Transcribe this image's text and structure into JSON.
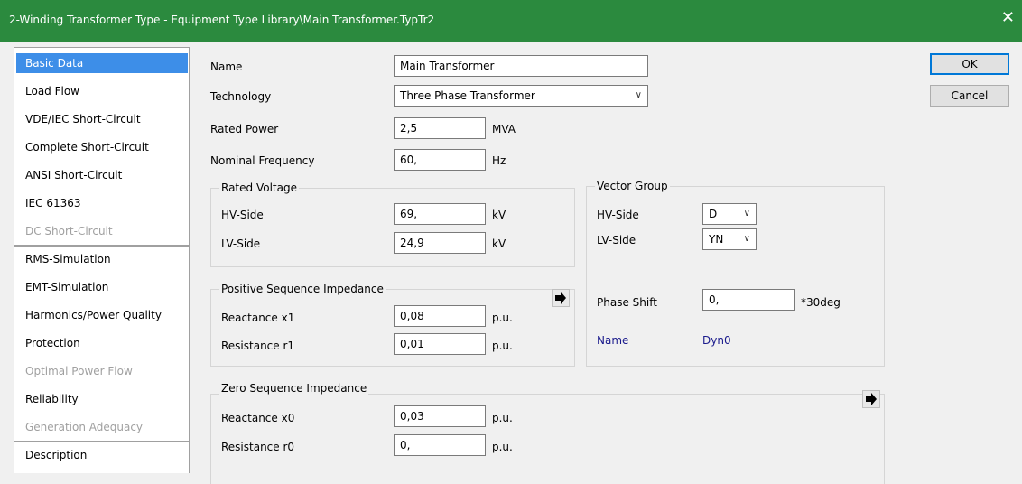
{
  "window": {
    "title": "2-Winding Transformer Type - Equipment Type Library\\Main Transformer.TypTr2",
    "close_glyph": "✕"
  },
  "sidebar": {
    "items": [
      {
        "label": "Basic Data",
        "state": "active"
      },
      {
        "label": "Load Flow",
        "state": "normal"
      },
      {
        "label": "VDE/IEC Short-Circuit",
        "state": "normal"
      },
      {
        "label": "Complete Short-Circuit",
        "state": "normal"
      },
      {
        "label": "ANSI Short-Circuit",
        "state": "normal"
      },
      {
        "label": "IEC 61363",
        "state": "normal"
      },
      {
        "label": "DC Short-Circuit",
        "state": "disabled"
      },
      {
        "label": "RMS-Simulation",
        "state": "normal"
      },
      {
        "label": "EMT-Simulation",
        "state": "normal"
      },
      {
        "label": "Harmonics/Power Quality",
        "state": "normal"
      },
      {
        "label": "Protection",
        "state": "normal"
      },
      {
        "label": "Optimal Power Flow",
        "state": "disabled"
      },
      {
        "label": "Reliability",
        "state": "normal"
      },
      {
        "label": "Generation Adequacy",
        "state": "disabled"
      },
      {
        "label": "Description",
        "state": "normal"
      }
    ]
  },
  "form": {
    "name": {
      "label": "Name",
      "value": "Main Transformer"
    },
    "technology": {
      "label": "Technology",
      "value": "Three Phase Transformer"
    },
    "rated_power": {
      "label": "Rated Power",
      "value": "2,5",
      "unit": "MVA"
    },
    "nominal_frequency": {
      "label": "Nominal Frequency",
      "value": "60,",
      "unit": "Hz"
    },
    "rated_voltage": {
      "title": "Rated Voltage",
      "hv": {
        "label": "HV-Side",
        "value": "69,",
        "unit": "kV"
      },
      "lv": {
        "label": "LV-Side",
        "value": "24,9",
        "unit": "kV"
      }
    },
    "positive_sequence": {
      "title": "Positive Sequence Impedance",
      "x1": {
        "label": "Reactance x1",
        "value": "0,08",
        "unit": "p.u."
      },
      "r1": {
        "label": "Resistance r1",
        "value": "0,01",
        "unit": "p.u."
      }
    },
    "zero_sequence": {
      "title": "Zero Sequence Impedance",
      "x0": {
        "label": "Reactance x0",
        "value": "0,03",
        "unit": "p.u."
      },
      "r0": {
        "label": "Resistance r0",
        "value": "0,",
        "unit": "p.u."
      }
    },
    "vector_group": {
      "title": "Vector Group",
      "hv": {
        "label": "HV-Side",
        "value": "D"
      },
      "lv": {
        "label": "LV-Side",
        "value": "YN"
      },
      "phase_shift": {
        "label": "Phase Shift",
        "value": "0,",
        "unit": "*30deg"
      },
      "name": {
        "label": "Name",
        "value": "Dyn0"
      }
    }
  },
  "buttons": {
    "ok": "OK",
    "cancel": "Cancel"
  },
  "colors": {
    "titlebar": "#2b8a3e",
    "selection": "#3d8ee8",
    "blue_text": "#1a1a8c"
  }
}
